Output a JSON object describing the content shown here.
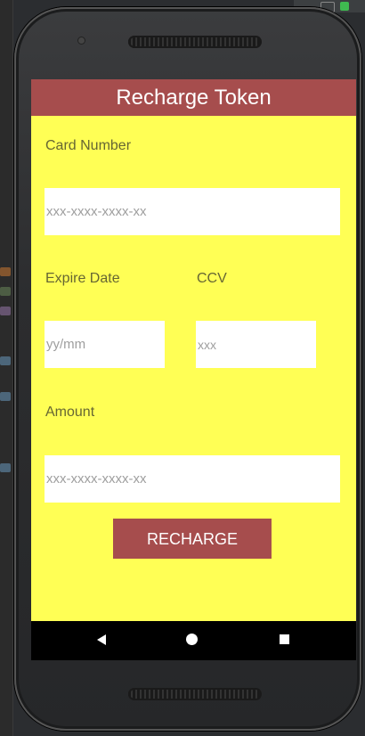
{
  "app": {
    "title": "Recharge Token"
  },
  "form": {
    "card_number_label": "Card Number",
    "card_number_placeholder": "xxx-xxxx-xxxx-xx",
    "expire_date_label": "Expire Date",
    "expire_date_placeholder": "yy/mm",
    "ccv_label": "CCV",
    "ccv_placeholder": "xxx",
    "amount_label": "Amount",
    "amount_placeholder": "xxx-xxxx-xxxx-xx",
    "submit_label": "RECHARGE"
  },
  "navbar": {
    "back_icon": "back-triangle-icon",
    "home_icon": "home-circle-icon",
    "recents_icon": "recents-square-icon"
  },
  "colors": {
    "accent": "#a64d4d",
    "background": "#ffff55",
    "label_text": "#666633",
    "placeholder_text": "#9e9e9e"
  }
}
